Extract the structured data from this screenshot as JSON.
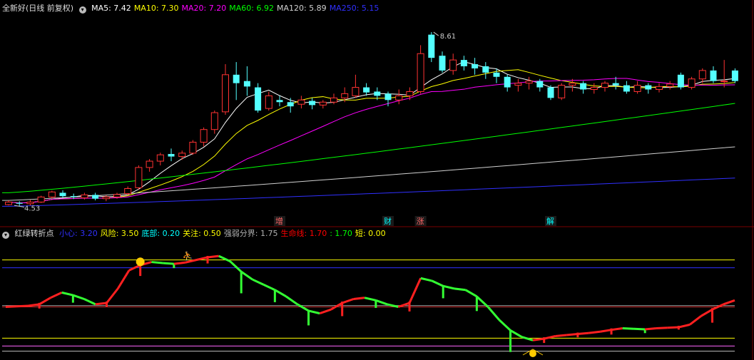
{
  "top": {
    "title": "全新好(日线 前复权)",
    "ma_labels": [
      {
        "label": "MA5: 7.42",
        "color": "#ffffff"
      },
      {
        "label": "MA10: 7.30",
        "color": "#ffff00"
      },
      {
        "label": "MA20: 7.20",
        "color": "#ff00ff"
      },
      {
        "label": "MA60: 6.92",
        "color": "#00ff00"
      },
      {
        "label": "MA120: 5.89",
        "color": "#d0d0d0"
      },
      {
        "label": "MA250: 5.15",
        "color": "#3030ff"
      }
    ]
  },
  "bottom": {
    "title": "红绿转折点",
    "labels": [
      {
        "label": "小心: 3.20",
        "color": "#3030ff"
      },
      {
        "label": "风险: 3.50",
        "color": "#ffff00"
      },
      {
        "label": "底部: 0.20",
        "color": "#00ffff"
      },
      {
        "label": "关注: 0.50",
        "color": "#ffff00"
      },
      {
        "label": "强弱分界: 1.75",
        "color": "#b0b0b0"
      },
      {
        "label": "生命线: 1.70",
        "color": "#ff0000"
      },
      {
        "label": ": 1.70",
        "color": "#00ff00"
      },
      {
        "label": "短: 0.00",
        "color": "#ffff00"
      }
    ]
  },
  "chart_data": [
    {
      "type": "candlestick",
      "ylim": [
        4.3,
        9.0
      ],
      "high_label": "8.61",
      "low_label": "4.53",
      "event_labels": [
        {
          "text": "增",
          "index": 25
        },
        {
          "text": "财",
          "index": 35
        },
        {
          "text": "涨",
          "index": 38
        },
        {
          "text": "解",
          "index": 50
        }
      ],
      "colors": {
        "up": "#ff3232",
        "down": "#54ffff"
      },
      "candles": [
        [
          4.52,
          4.58,
          4.5,
          4.62
        ],
        [
          4.56,
          4.54,
          4.49,
          4.6
        ],
        [
          4.54,
          4.58,
          4.5,
          4.63
        ],
        [
          4.58,
          4.7,
          4.56,
          4.73
        ],
        [
          4.7,
          4.82,
          4.66,
          4.85
        ],
        [
          4.8,
          4.72,
          4.68,
          4.86
        ],
        [
          4.72,
          4.7,
          4.65,
          4.78
        ],
        [
          4.68,
          4.75,
          4.64,
          4.8
        ],
        [
          4.75,
          4.66,
          4.62,
          4.8
        ],
        [
          4.66,
          4.7,
          4.6,
          4.74
        ],
        [
          4.7,
          4.76,
          4.66,
          4.8
        ],
        [
          4.78,
          4.9,
          4.74,
          4.95
        ],
        [
          4.92,
          5.4,
          4.88,
          5.45
        ],
        [
          5.4,
          5.55,
          5.3,
          5.6
        ],
        [
          5.55,
          5.7,
          5.45,
          5.75
        ],
        [
          5.72,
          5.66,
          5.55,
          5.85
        ],
        [
          5.66,
          5.74,
          5.58,
          5.8
        ],
        [
          5.74,
          6.0,
          5.7,
          6.05
        ],
        [
          6.0,
          6.3,
          5.9,
          6.35
        ],
        [
          6.3,
          6.7,
          6.2,
          6.75
        ],
        [
          6.72,
          7.6,
          6.65,
          7.85
        ],
        [
          7.6,
          7.4,
          7.0,
          7.9
        ],
        [
          7.45,
          7.32,
          7.1,
          7.8
        ],
        [
          7.3,
          6.75,
          6.7,
          7.4
        ],
        [
          6.8,
          7.1,
          6.75,
          7.2
        ],
        [
          7.0,
          6.95,
          6.85,
          7.1
        ],
        [
          6.95,
          6.85,
          6.7,
          7.05
        ],
        [
          6.9,
          7.0,
          6.8,
          7.1
        ],
        [
          6.98,
          6.88,
          6.78,
          7.05
        ],
        [
          6.88,
          6.95,
          6.8,
          7.0
        ],
        [
          6.95,
          7.05,
          6.9,
          7.15
        ],
        [
          7.05,
          7.15,
          6.95,
          7.3
        ],
        [
          7.1,
          7.3,
          7.05,
          7.6
        ],
        [
          7.3,
          7.18,
          7.1,
          7.4
        ],
        [
          7.2,
          7.1,
          7.0,
          7.3
        ],
        [
          7.15,
          7.0,
          6.85,
          7.2
        ],
        [
          7.0,
          7.1,
          6.9,
          7.25
        ],
        [
          7.1,
          7.2,
          7.0,
          7.3
        ],
        [
          7.2,
          8.1,
          7.15,
          8.3
        ],
        [
          8.55,
          8.0,
          7.9,
          8.61
        ],
        [
          8.05,
          7.7,
          7.65,
          8.15
        ],
        [
          7.7,
          7.95,
          7.6,
          8.1
        ],
        [
          7.95,
          7.8,
          7.7,
          8.05
        ],
        [
          7.85,
          7.75,
          7.6,
          8.0
        ],
        [
          7.8,
          7.65,
          7.5,
          7.9
        ],
        [
          7.65,
          7.55,
          7.4,
          7.75
        ],
        [
          7.55,
          7.3,
          7.2,
          7.6
        ],
        [
          7.35,
          7.4,
          7.2,
          7.5
        ],
        [
          7.4,
          7.45,
          7.25,
          7.55
        ],
        [
          7.45,
          7.3,
          7.2,
          7.5
        ],
        [
          7.3,
          7.05,
          7.0,
          7.35
        ],
        [
          7.05,
          7.35,
          7.0,
          7.4
        ],
        [
          7.35,
          7.4,
          7.2,
          7.5
        ],
        [
          7.4,
          7.25,
          7.15,
          7.45
        ],
        [
          7.25,
          7.3,
          7.15,
          7.4
        ],
        [
          7.3,
          7.4,
          7.2,
          7.45
        ],
        [
          7.4,
          7.35,
          7.25,
          7.55
        ],
        [
          7.35,
          7.2,
          7.15,
          7.45
        ],
        [
          7.2,
          7.35,
          7.15,
          7.45
        ],
        [
          7.35,
          7.25,
          7.15,
          7.4
        ],
        [
          7.25,
          7.32,
          7.18,
          7.4
        ],
        [
          7.32,
          7.38,
          7.25,
          7.45
        ],
        [
          7.6,
          7.3,
          7.25,
          7.65
        ],
        [
          7.3,
          7.5,
          7.25,
          7.55
        ],
        [
          7.5,
          7.7,
          7.4,
          7.75
        ],
        [
          7.7,
          7.45,
          7.4,
          7.8
        ],
        [
          7.45,
          7.45,
          7.3,
          7.95
        ],
        [
          7.7,
          7.45,
          7.4,
          7.75
        ]
      ],
      "ma_series": [
        {
          "name": "MA5",
          "color": "#ffffff"
        },
        {
          "name": "MA10",
          "color": "#ffff00"
        },
        {
          "name": "MA20",
          "color": "#ff00ff"
        },
        {
          "name": "MA60",
          "color": "#00ff00",
          "start": 4.8,
          "end": 6.92
        },
        {
          "name": "MA120",
          "color": "#d0d0d0",
          "start": 4.62,
          "end": 5.89
        },
        {
          "name": "MA250",
          "color": "#3030ff",
          "start": 4.48,
          "end": 5.15
        }
      ]
    },
    {
      "type": "line",
      "ylim": [
        -0.2,
        3.9
      ],
      "levels": [
        {
          "value": 3.5,
          "color": "#ffff00"
        },
        {
          "value": 3.2,
          "color": "#3030ff"
        },
        {
          "value": 1.75,
          "color": "#9a9a9a"
        },
        {
          "value": 1.7,
          "color": "#cc3030"
        },
        {
          "value": 0.5,
          "color": "#ffff00"
        },
        {
          "value": 0.2,
          "color": "#ff66ff"
        },
        {
          "value": 0.0,
          "color": "#bbbbbb"
        }
      ],
      "values": [
        1.7,
        1.72,
        1.74,
        1.8,
        2.05,
        2.25,
        2.15,
        2.0,
        1.8,
        1.85,
        2.4,
        3.1,
        3.3,
        3.42,
        3.38,
        3.35,
        3.4,
        3.5,
        3.6,
        3.65,
        3.45,
        3.05,
        2.75,
        2.55,
        2.35,
        2.1,
        1.8,
        1.55,
        1.45,
        1.6,
        1.85,
        2.0,
        2.05,
        1.95,
        1.8,
        1.7,
        1.85,
        2.8,
        2.7,
        2.5,
        2.4,
        2.35,
        2.1,
        1.7,
        1.2,
        0.8,
        0.55,
        0.42,
        0.48,
        0.58,
        0.62,
        0.66,
        0.7,
        0.75,
        0.82,
        0.88,
        0.86,
        0.84,
        0.88,
        0.9,
        0.92,
        1.02,
        1.35,
        1.6,
        1.8,
        1.95
      ],
      "colors": {
        "up": "#ff2020",
        "down": "#33ff33"
      }
    }
  ]
}
